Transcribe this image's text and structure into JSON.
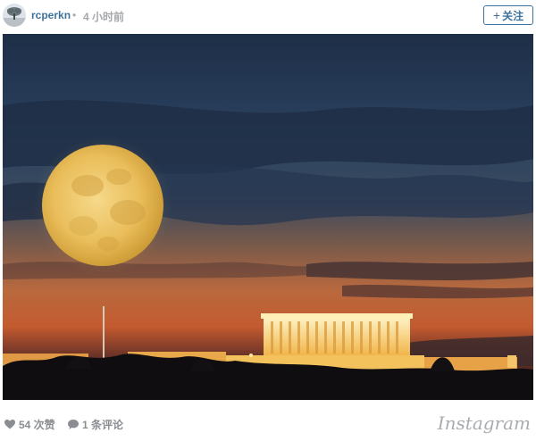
{
  "header": {
    "username": "rcperkn",
    "separator": "•",
    "time_ago": "4 小时前",
    "follow_label": "关注",
    "follow_plus": "+"
  },
  "footer": {
    "likes_count": "54 次赞",
    "comments_count": "1 条评论",
    "brand": "Instagram"
  },
  "icons": {
    "avatar": "avatar-tree",
    "like": "heart-icon",
    "comment": "comment-bubble-icon",
    "follow": "plus-icon"
  },
  "colors": {
    "link": "#3f729b",
    "muted": "#8a8d91",
    "brand": "#a9acb0"
  }
}
